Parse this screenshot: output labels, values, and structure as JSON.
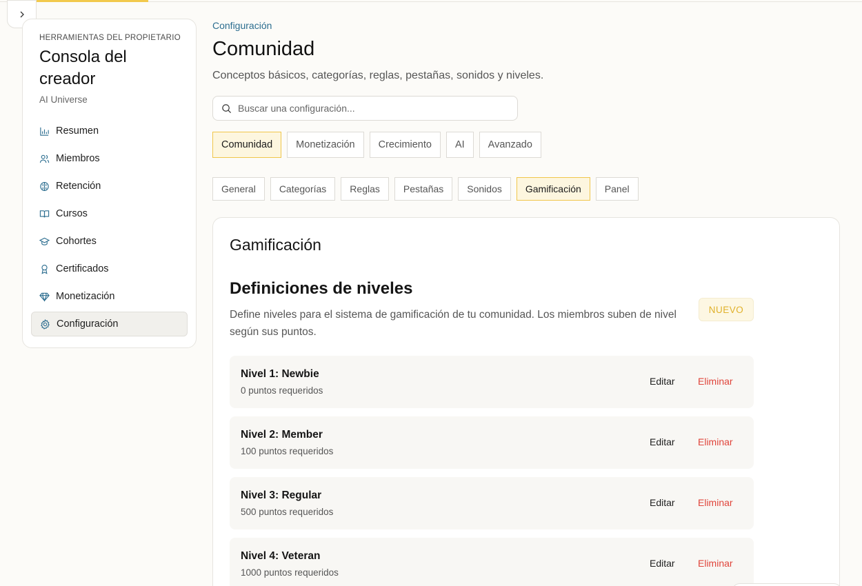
{
  "sidebar": {
    "eyebrow": "HERRAMIENTAS DEL PROPIETARIO",
    "title": "Consola del creador",
    "subtitle": "AI Universe",
    "items": [
      {
        "label": "Resumen",
        "icon": "bar-chart-icon"
      },
      {
        "label": "Miembros",
        "icon": "users-icon"
      },
      {
        "label": "Retención",
        "icon": "brain-icon"
      },
      {
        "label": "Cursos",
        "icon": "book-icon"
      },
      {
        "label": "Cohortes",
        "icon": "graduation-cap-icon"
      },
      {
        "label": "Certificados",
        "icon": "award-icon"
      },
      {
        "label": "Monetización",
        "icon": "gem-icon"
      },
      {
        "label": "Configuración",
        "icon": "gear-icon",
        "active": true
      }
    ]
  },
  "header": {
    "breadcrumb": "Configuración",
    "title": "Comunidad",
    "subtitle": "Conceptos básicos, categorías, reglas, pestañas, sonidos y niveles."
  },
  "search": {
    "placeholder": "Buscar una configuración..."
  },
  "main_tabs": [
    "Comunidad",
    "Monetización",
    "Crecimiento",
    "AI",
    "Avanzado"
  ],
  "main_tab_active": "Comunidad",
  "sub_tabs": [
    "General",
    "Categorías",
    "Reglas",
    "Pestañas",
    "Sonidos",
    "Gamificación",
    "Panel"
  ],
  "sub_tab_active": "Gamificación",
  "card": {
    "title": "Gamificación",
    "section_title": "Definiciones de niveles",
    "section_desc": "Define niveles para el sistema de gamificación de tu comunidad. Los miembros suben de nivel según sus puntos.",
    "badge": "NUEVO",
    "edit_label": "Editar",
    "delete_label": "Eliminar",
    "levels": [
      {
        "name": "Nivel 1: Newbie",
        "points": "0 puntos requeridos"
      },
      {
        "name": "Nivel 2: Member",
        "points": "100 puntos requeridos"
      },
      {
        "name": "Nivel 3: Regular",
        "points": "500 puntos requeridos"
      },
      {
        "name": "Nivel 4: Veteran",
        "points": "1000 puntos requeridos"
      }
    ]
  },
  "colors": {
    "accent": "#f2c94c",
    "link": "#2b6d8f",
    "danger": "#e0443a",
    "icon": "#2b6d8f"
  }
}
